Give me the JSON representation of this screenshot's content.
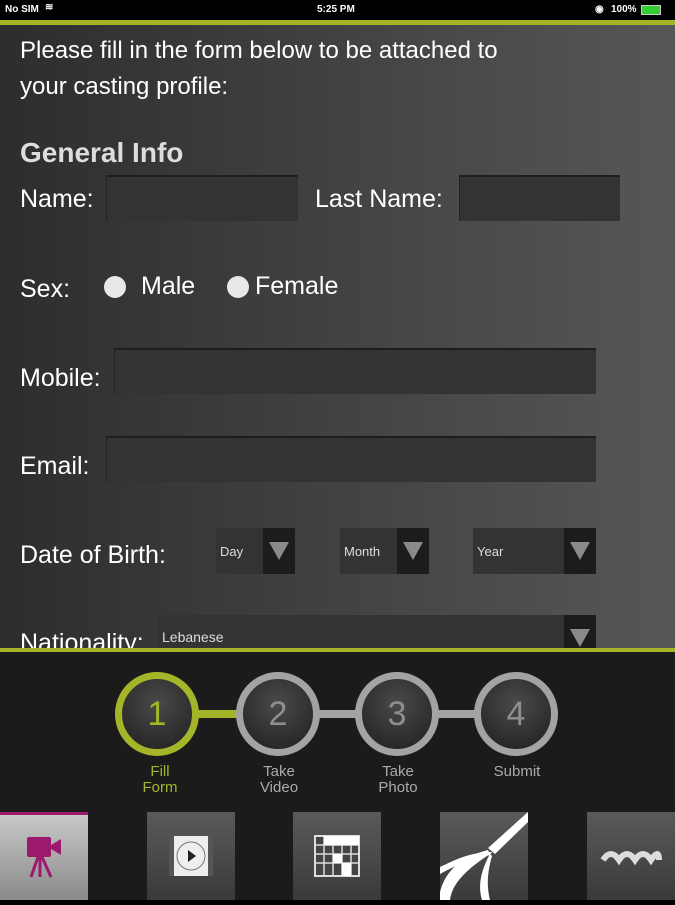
{
  "status_bar": {
    "carrier": "No SIM",
    "time": "5:25 PM",
    "battery": "100%"
  },
  "form": {
    "intro": "Please fill in the form below to be attached to your casting profile:",
    "section_title": "General Info",
    "name_label": "Name:",
    "last_name_label": "Last Name:",
    "name_value": "",
    "last_name_value": "",
    "sex_label": "Sex:",
    "male_label": "Male",
    "female_label": "Female",
    "mobile_label": "Mobile:",
    "mobile_value": "",
    "email_label": "Email:",
    "email_value": "",
    "dob_label": "Date of Birth:",
    "day": "Day",
    "month": "Month",
    "year": "Year",
    "nationality_label": "Nationality:",
    "nationality": "Lebanese"
  },
  "steps": [
    {
      "number": "1",
      "label": "Fill Form",
      "active": true
    },
    {
      "number": "2",
      "label": "Take Video",
      "active": false
    },
    {
      "number": "3",
      "label": "Take Photo",
      "active": false
    },
    {
      "number": "4",
      "label": "Submit",
      "active": false
    }
  ],
  "tabs": [
    {
      "icon": "video-camera-icon",
      "active": true
    },
    {
      "icon": "film-play-icon",
      "active": false
    },
    {
      "icon": "grid-icon",
      "active": false
    },
    {
      "icon": "pen-stripes-icon",
      "active": false
    },
    {
      "icon": "more-icon",
      "active": false
    }
  ],
  "colors": {
    "accent": "#a4b52a",
    "active_tab_icon": "#9c1a6e"
  }
}
